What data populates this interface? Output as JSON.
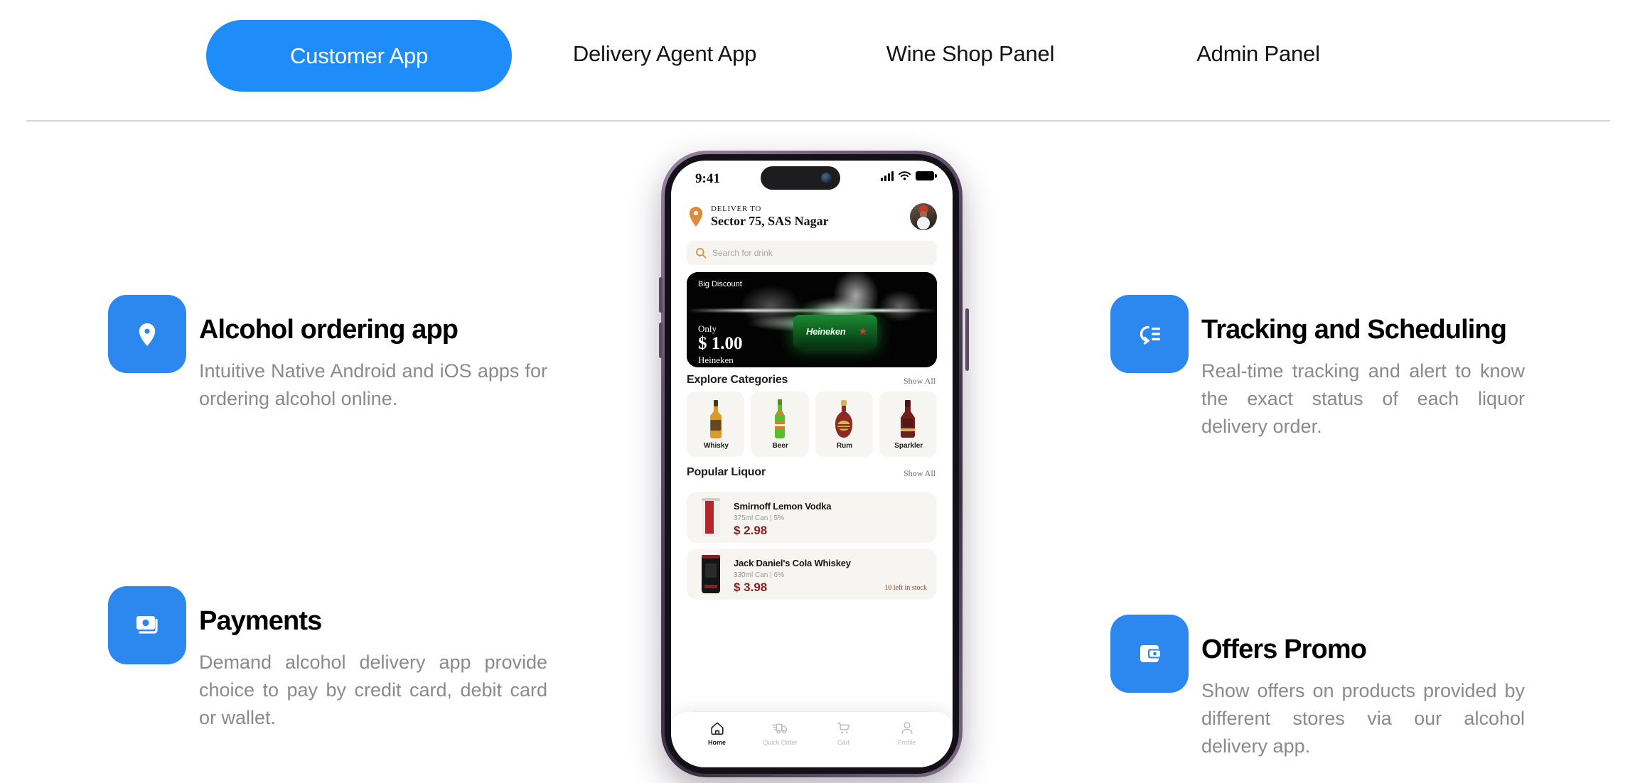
{
  "tabs": [
    {
      "label": "Customer App",
      "active": true
    },
    {
      "label": "Delivery Agent App",
      "active": false
    },
    {
      "label": "Wine Shop Panel",
      "active": false
    },
    {
      "label": "Admin Panel",
      "active": false
    }
  ],
  "colors": {
    "accent_blue": "#1f8df9",
    "icon_blue": "#2c87ee",
    "title_black": "#000000",
    "body_gray": "#8a8a8a",
    "divider": "#d4d4d4",
    "price_red": "#8d2020",
    "stock_red": "#a83b2c",
    "pin_orange": "#e08a3c"
  },
  "features_left": [
    {
      "icon": "location-pin-icon",
      "title": "Alcohol ordering app",
      "desc": "Intuitive Native Android and iOS apps for ordering alcohol online."
    },
    {
      "icon": "payment-cards-icon",
      "title": "Payments",
      "desc": "Demand alcohol delivery app provide choice to pay by credit card, debit card or wallet."
    }
  ],
  "features_right": [
    {
      "icon": "tracking-list-icon",
      "title": "Tracking and Scheduling",
      "desc": "Real-time tracking and alert to know the exact status of each liquor delivery order."
    },
    {
      "icon": "wallet-offer-icon",
      "title": "Offers Promo",
      "desc": "Show offers on products provided by different stores via our alcohol delivery app."
    }
  ],
  "phone": {
    "status": {
      "time": "9:41",
      "signal_icon": "cellular-signal-icon",
      "wifi_icon": "wifi-icon",
      "battery_icon": "battery-full-icon"
    },
    "header": {
      "pin_icon": "map-pin-icon",
      "deliver_to_label": "DELIVER TO",
      "location": "Sector 75, SAS Nagar",
      "avatar": "user-avatar"
    },
    "search": {
      "icon": "search-icon",
      "placeholder": "Search for drink"
    },
    "banner": {
      "tag": "Big Discount",
      "only_label": "Only",
      "price": "$ 1.00",
      "brand": "Heineken",
      "bottle_label": "Heineken"
    },
    "categories_section": {
      "title": "Explore Categories",
      "show_all": "Show All"
    },
    "categories": [
      {
        "name": "Whisky",
        "bottle_color": "#d99a2b",
        "cap_color": "#4a3522"
      },
      {
        "name": "Beer",
        "bottle_color": "#5cbb30",
        "cap_color": "#4b8f22"
      },
      {
        "name": "Rum",
        "bottle_color": "#8e2a22",
        "cap_color": "#d8b257"
      },
      {
        "name": "Sparkler",
        "bottle_color": "#6d1f1c",
        "cap_color": "#4e1513"
      }
    ],
    "popular_section": {
      "title": "Popular Liquor",
      "show_all": "Show All"
    },
    "products": [
      {
        "name": "Smirnoff Lemon Vodka",
        "meta": "375ml Can  |  5%",
        "price": "$ 2.98",
        "stock": "",
        "can_color": "#f0eeec",
        "can_accent": "#b3262c"
      },
      {
        "name": "Jack Daniel's Cola Whiskey",
        "meta": "330ml Can  |  6%",
        "price": "$ 3.98",
        "stock": "10 left in stock",
        "can_color": "#151515",
        "can_accent": "#8a1d1d"
      }
    ],
    "bottom_nav": [
      {
        "label": "Home",
        "icon": "home-icon",
        "active": true
      },
      {
        "label": "Quick Order",
        "icon": "truck-icon",
        "active": false
      },
      {
        "label": "Cart",
        "icon": "cart-icon",
        "active": false
      },
      {
        "label": "Profile",
        "icon": "profile-icon",
        "active": false
      }
    ]
  }
}
